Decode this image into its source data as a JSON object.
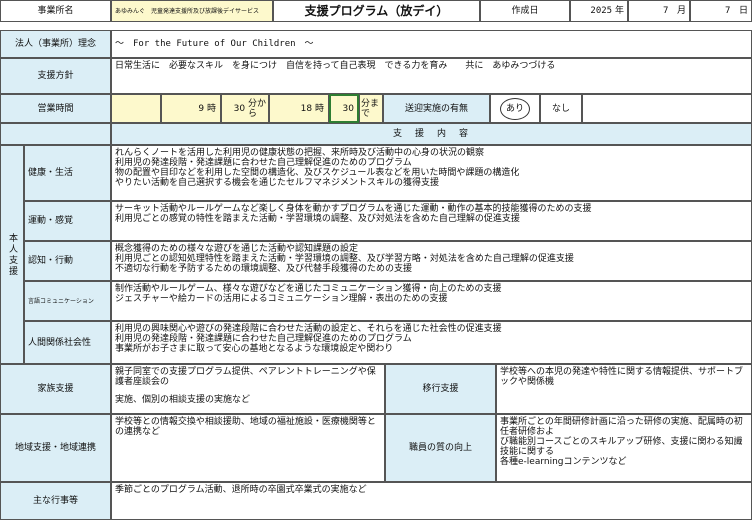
{
  "header": {
    "office_label": "事業所名",
    "office_name": "あゆみんぐ　児童発達支援所及び放課後デイサービス",
    "title": "支援プログラム（放デイ）",
    "date_label": "作成日",
    "year": "2025",
    "year_unit": "年",
    "month": "7",
    "month_unit": "月",
    "day": "7",
    "day_unit": "日"
  },
  "philosophy": {
    "label": "法人（事業所）理念",
    "value": "～　For the Future of Our Children　～"
  },
  "policy": {
    "label": "支援方針",
    "value": "日常生活に　必要なスキル　を身につけ　自信を持って自己表現　できる力を育み　　共に　あゆみつづける"
  },
  "hours": {
    "label": "営業時間",
    "start_hour": "9",
    "hour_unit": "時",
    "start_min": "30",
    "from_unit": "分から",
    "end_hour": "18",
    "end_min": "30",
    "until_unit": "分まで",
    "transport_label": "送迎実施の有無",
    "yes": "あり",
    "no": "なし"
  },
  "support_header": "支　援　内　容",
  "person_label": "本人支援",
  "person_sections": [
    {
      "label": "健康・生活",
      "lines": [
        "れんらくノートを活用した利用児の健康状態の把握、来所時及び活動中の心身の状況の観察",
        "利用児の発達段階・発達課題に合わせた自己理解促進のためのプログラム",
        "物の配置や目印などを利用した空間の構造化、及びスケジュール表などを用いた時間や課題の構造化",
        "やりたい活動を自己選択する機会を通じたセルフマネジメントスキルの獲得支援"
      ]
    },
    {
      "label": "運動・感覚",
      "lines": [
        "サーキット活動やルールゲームなど楽しく身体を動かすプログラムを通じた運動・動作の基本的技能獲得のための支援",
        "利用児ごとの感覚の特性を踏まえた活動・学習環境の調整、及び対処法を含めた自己理解の促進支援"
      ]
    },
    {
      "label": "認知・行動",
      "lines": [
        "概念獲得のための様々な遊びを通じた活動や認知課題の設定",
        "利用児ごとの認知処理特性を踏まえた活動・学習環境の調整、及び学習方略・対処法を含めた自己理解の促進支援",
        "不適切な行動を予防するための環境調整、及び代替手段獲得のための支援"
      ]
    },
    {
      "label": "言語コミュニケーション",
      "lines": [
        "制作活動やルールゲーム、様々な遊びなどを通じたコミュニケーション獲得・向上のための支援",
        "ジェスチャーや絵カードの活用によるコミュニケーション理解・表出のための支援"
      ]
    },
    {
      "label": "人間関係社会性",
      "lines": [
        "利用児の興味関心や遊びの発達段階に合わせた活動の設定と、それらを通じた社会性の促進支援",
        "利用児の発達段階・発達課題に合わせた自己理解促進のためのプログラム",
        "事業所がお子さまに取って安心の基地となるような環境設定や関わり"
      ]
    }
  ],
  "family": {
    "label": "家族支援",
    "lines": [
      "親子同室での支援プログラム提供、ペアレントトレーニングや保護者座談会の",
      "実施、個別の相談支援の実施など"
    ]
  },
  "transition": {
    "label": "移行支援",
    "lines": [
      "学校等への本児の発達や特性に関する情報提供、サポートブックや関係機"
    ]
  },
  "community": {
    "label": "地域支援・地域連携",
    "lines": [
      "学校等との情報交換や相談援助、地域の福祉施設・医療機関等との連携など"
    ]
  },
  "staff": {
    "label": "職員の質の向上",
    "lines": [
      "事業所ごとの年間研修計画に沿った研修の実施、配属時の初任者研修およ",
      "び職能別コースごとのスキルアップ研修、支援に関わる知識技能に関する",
      "各種e-learningコンテンツなど"
    ]
  },
  "events": {
    "label": "主な行事等",
    "value": "季節ごとのプログラム活動、退所時の卒園式卒業式の実施など"
  }
}
